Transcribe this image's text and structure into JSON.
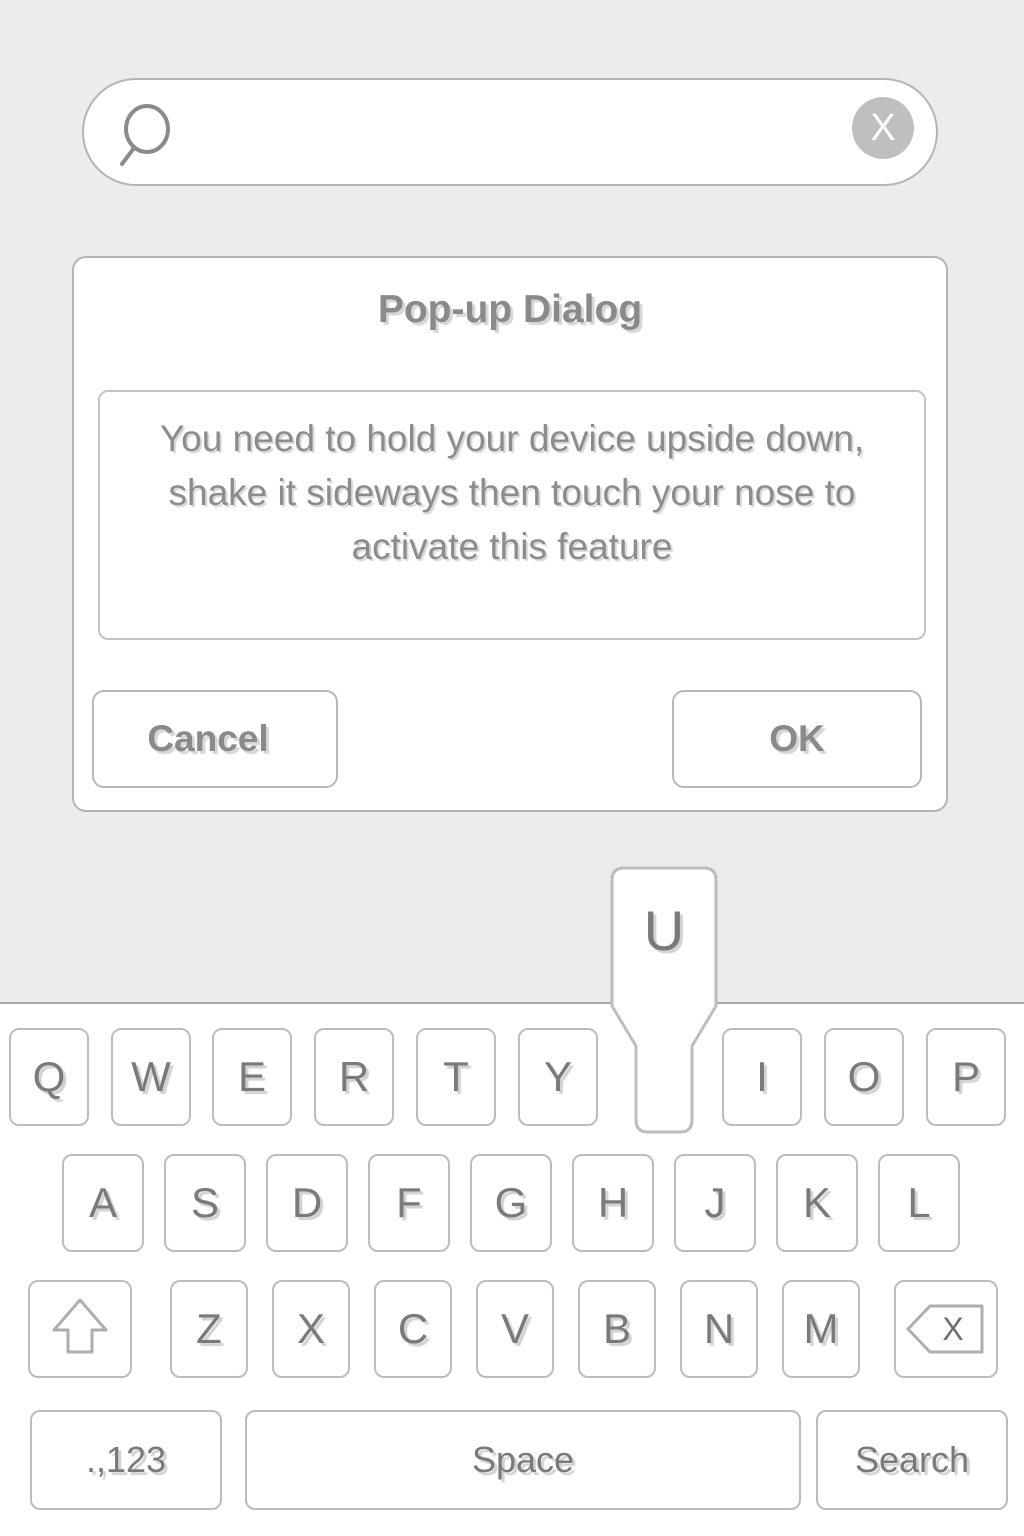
{
  "search": {
    "icon": "search-icon",
    "value": "",
    "placeholder": "",
    "clear_label": "X",
    "clear_icon": "close-circle-icon"
  },
  "dialog": {
    "title": "Pop-up Dialog",
    "message": "You need to hold your device upside down, shake it sideways then touch your nose to activate this feature",
    "cancel_label": "Cancel",
    "ok_label": "OK"
  },
  "key_popup": {
    "label": "U"
  },
  "keyboard": {
    "row1": [
      "Q",
      "W",
      "E",
      "R",
      "T",
      "Y",
      "U",
      "I",
      "O",
      "P"
    ],
    "row2": [
      "A",
      "S",
      "D",
      "F",
      "G",
      "H",
      "J",
      "K",
      "L"
    ],
    "row3": [
      "Z",
      "X",
      "C",
      "V",
      "B",
      "N",
      "M"
    ],
    "shift_icon": "shift-arrow-up-icon",
    "backspace_icon": "backspace-icon",
    "backspace_label": "X",
    "numbers_label": ".,123",
    "space_label": "Space",
    "search_label": "Search"
  },
  "colors": {
    "background": "#ececec",
    "surface": "#ffffff",
    "border": "#b4b4b8",
    "text": "#7a7a7a",
    "clear_button": "#bfbfbf"
  }
}
